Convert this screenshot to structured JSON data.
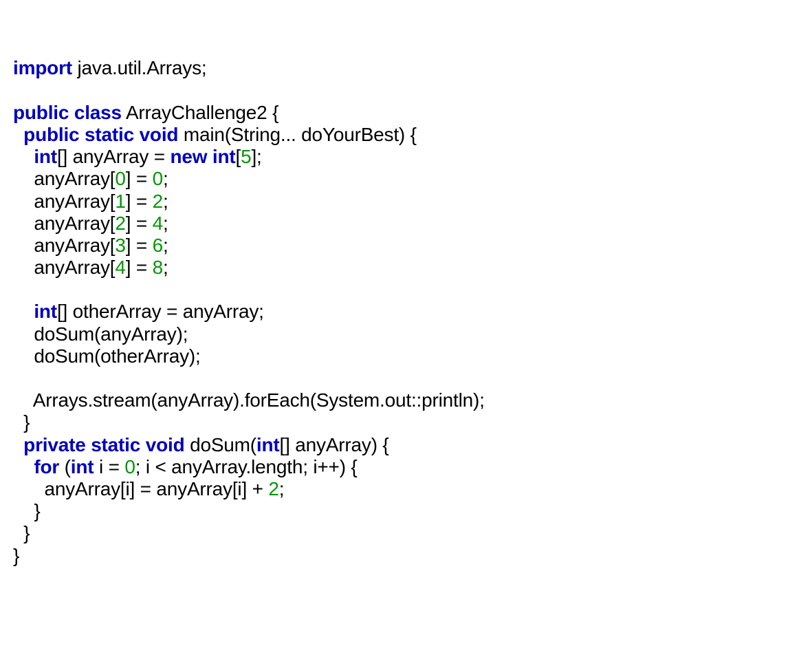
{
  "code": {
    "kw_import": "import",
    "pkg": " java.util.Arrays;",
    "kw_public1": "public",
    "kw_class": "class",
    "cls_name": " ArrayChallenge2 {",
    "kw_public2": "public",
    "kw_static1": "static",
    "kw_void1": "void",
    "main_sig": " main(String... doYourBest) {",
    "kw_int1": "int",
    "arr_decl1": "[] anyArray = ",
    "kw_new": "new",
    "kw_int2": "int",
    "lbr": "[",
    "five": "5",
    "rbr_semi": "];",
    "a0_l": "    anyArray[",
    "n0": "0",
    "a0_m": "] = ",
    "v0": "0",
    "a0_r": ";",
    "a1_l": "    anyArray[",
    "n1": "1",
    "a1_m": "] = ",
    "v1": "2",
    "a1_r": ";",
    "a2_l": "    anyArray[",
    "n2": "2",
    "a2_m": "] = ",
    "v2": "4",
    "a2_r": ";",
    "a3_l": "    anyArray[",
    "n3": "3",
    "a3_m": "] = ",
    "v3": "6",
    "a3_r": ";",
    "a4_l": "    anyArray[",
    "n4": "4",
    "a4_m": "] = ",
    "v4": "8",
    "a4_r": ";",
    "kw_int3": "int",
    "other_decl": "[] otherArray = anyArray;",
    "dosum1": "    doSum(anyArray);",
    "dosum2": "    doSum(otherArray);",
    "stream": "    Arrays.stream(anyArray).forEach(System.out::println);",
    "close_main": "  }",
    "kw_private": "private",
    "kw_static2": "static",
    "kw_void2": "void",
    "dosum_sig": " doSum(",
    "kw_int4": "int",
    "dosum_sig2": "[] anyArray) {",
    "kw_for": "for",
    "for_open": " (",
    "kw_int5": "int",
    "for_i": " i = ",
    "zero": "0",
    "for_cond": "; i < anyArray.length; i++) {",
    "sum_l": "      anyArray[i] = anyArray[i] + ",
    "two": "2",
    "sum_r": ";",
    "close_for": "    }",
    "close_dosum": "  }",
    "close_class": "}"
  }
}
